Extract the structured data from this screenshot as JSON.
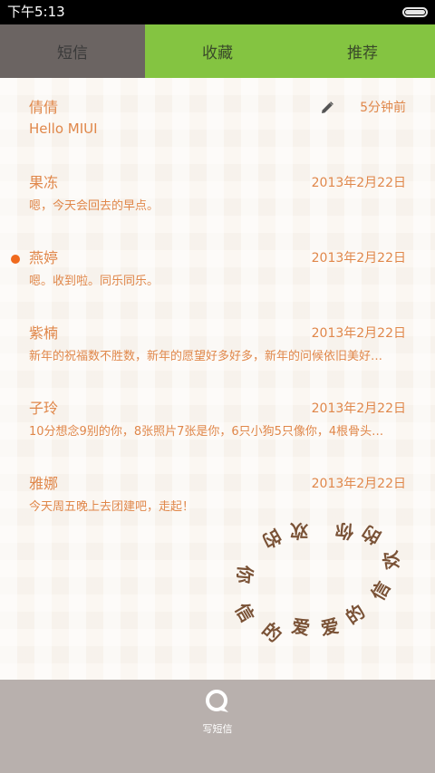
{
  "status_bar": {
    "time": "下午5:13"
  },
  "tabs": [
    {
      "label": "短信",
      "active": true
    },
    {
      "label": "收藏",
      "active": false
    },
    {
      "label": "推荐",
      "active": false
    }
  ],
  "messages": [
    {
      "name": "倩倩",
      "time": "5分钟前",
      "preview": "Hello MIUI",
      "draft": true,
      "unread": false
    },
    {
      "name": "果冻",
      "time": "2013年2月22日",
      "preview": "嗯，今天会回去的早点。",
      "draft": false,
      "unread": false
    },
    {
      "name": "燕婷",
      "time": "2013年2月22日",
      "preview": "嗯。收到啦。同乐同乐。",
      "draft": false,
      "unread": true
    },
    {
      "name": "紫楠",
      "time": "2013年2月22日",
      "preview": "新年的祝福数不胜数，新年的愿望好多好多，新年的问候依旧美好…",
      "draft": false,
      "unread": false
    },
    {
      "name": "子玲",
      "time": "2013年2月22日",
      "preview": "10分想念9别的你，8张照片7张是你，6只小狗5只像你，4根骨头…",
      "draft": false,
      "unread": false
    },
    {
      "name": "雅娜",
      "time": "2013年2月22日",
      "preview": "今天周五晚上去团建吧，走起！",
      "draft": false,
      "unread": false
    }
  ],
  "heart_chars": [
    "你",
    "的",
    "欢",
    "信",
    "的",
    "爱",
    "爱",
    "的",
    "信",
    "欢",
    "的",
    "你"
  ],
  "bottom_bar": {
    "compose_label": "写短信"
  },
  "colors": {
    "accent_text": "#e0874a",
    "tab_active": "#6b6462",
    "tab_inactive": "#84c441",
    "unread_dot": "#f06a1e",
    "bottom_bar": "#b8b0ad",
    "heart_text": "#7a5236"
  },
  "icons": {
    "draft": "pencil-icon",
    "compose": "chat-bubble-icon",
    "battery": "battery-icon"
  }
}
